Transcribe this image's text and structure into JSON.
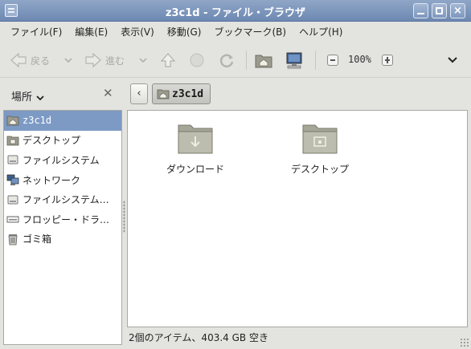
{
  "window": {
    "title": "z3c1d - ファイル・ブラウザ"
  },
  "menu": [
    "ファイル(F)",
    "編集(E)",
    "表示(V)",
    "移動(G)",
    "ブックマーク(B)",
    "ヘルプ(H)"
  ],
  "toolbar": {
    "back_label": "戻る",
    "forward_label": "進む",
    "zoom_value": "100%"
  },
  "sidebar": {
    "header_label": "場所",
    "items": [
      {
        "label": "z3c1d",
        "icon": "home-icon",
        "selected": true
      },
      {
        "label": "デスクトップ",
        "icon": "desktop-folder-icon",
        "selected": false
      },
      {
        "label": "ファイルシステム",
        "icon": "drive-icon",
        "selected": false
      },
      {
        "label": "ネットワーク",
        "icon": "network-icon",
        "selected": false
      },
      {
        "label": "ファイルシステム…",
        "icon": "drive-icon",
        "selected": false
      },
      {
        "label": "フロッピー・ドラ…",
        "icon": "floppy-icon",
        "selected": false
      },
      {
        "label": "ゴミ箱",
        "icon": "trash-icon",
        "selected": false
      }
    ]
  },
  "location": {
    "crumb": "z3c1d"
  },
  "files": [
    {
      "name": "ダウンロード",
      "icon": "downloads-folder-icon"
    },
    {
      "name": "デスクトップ",
      "icon": "desktop-folder-icon"
    }
  ],
  "status": {
    "text": "2個のアイテム、403.4 GB 空き"
  },
  "colors": {
    "titlebar": "#7d96bd",
    "selection": "#7d9ac5",
    "folder": "#b5b5a6"
  }
}
